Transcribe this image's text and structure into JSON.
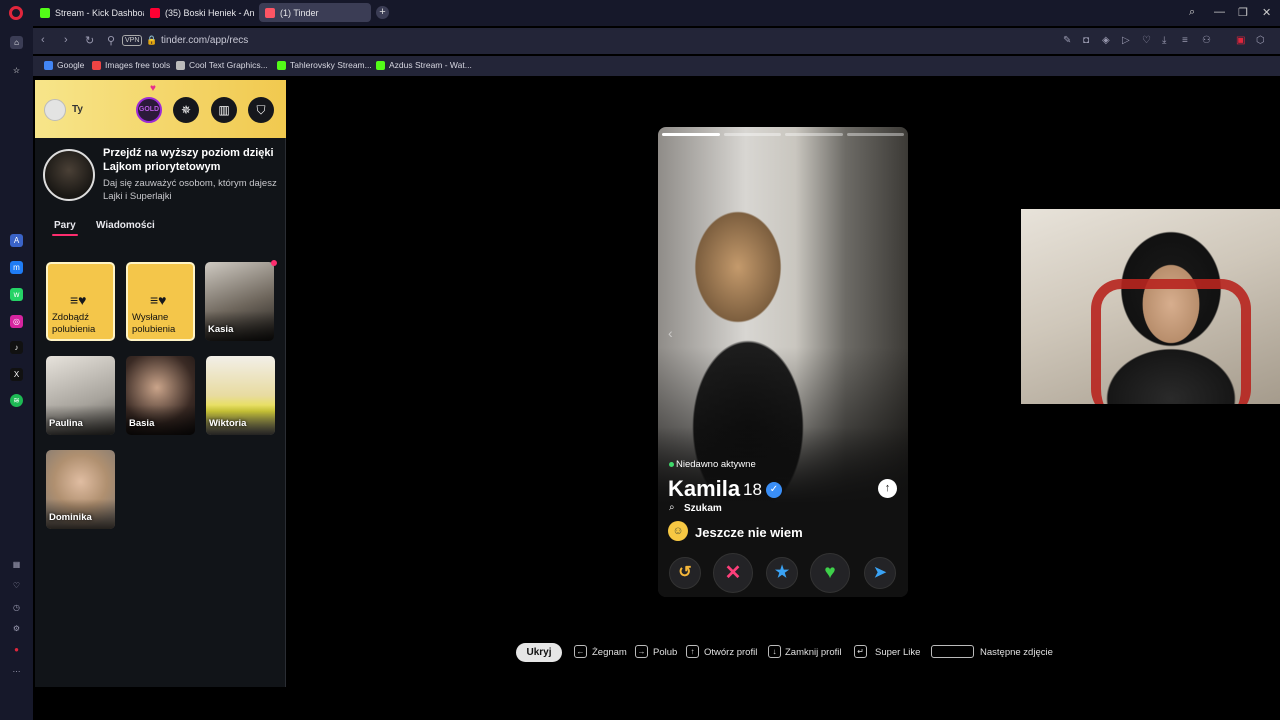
{
  "browser": {
    "tabs": [
      {
        "label": "Stream - Kick Dashboard",
        "color": "#53fc18"
      },
      {
        "label": "(35) Boski Heniek - An",
        "color": "#ff0033"
      },
      {
        "label": "(1) Tinder",
        "color": "#fd5564"
      }
    ],
    "url": "tinder.com/app/recs",
    "vpn": "VPN",
    "bookmarks": [
      {
        "label": "Google",
        "color": "#4285f4"
      },
      {
        "label": "Images free tools",
        "color": "#e44"
      },
      {
        "label": "Cool Text Graphics...",
        "color": "#bbb"
      },
      {
        "label": "Tahlerovsky Stream...",
        "color": "#53fc18"
      },
      {
        "label": "Azdus Stream - Wat...",
        "color": "#53fc18"
      }
    ]
  },
  "panel": {
    "user_label": "Ty",
    "gold_badge": "GOLD",
    "promo": {
      "title": "Przejdź na wyższy poziom dzięki Lajkom priorytetowym",
      "subtitle": "Daj się zauważyć osobom, którym dajesz Lajki i Superlajki"
    },
    "tabs": {
      "matches": "Pary",
      "messages": "Wiadomości"
    },
    "gold_cards": [
      {
        "label": "Zdobądź polubienia"
      },
      {
        "label": "Wysłane polubienia"
      }
    ],
    "matches": [
      {
        "name": "Kasia"
      },
      {
        "name": "Paulina"
      },
      {
        "name": "Basia"
      },
      {
        "name": "Wiktoria"
      },
      {
        "name": "Dominika"
      }
    ]
  },
  "profile": {
    "status": "Niedawno aktywne",
    "name": "Kamila",
    "age": "18",
    "looking_label": "Szukam",
    "intent": "Jeszcze nie wiem",
    "photo_count": 4,
    "current_photo": 1
  },
  "shortcuts": {
    "hide": "Ukryj",
    "items": [
      {
        "key": "←",
        "label": "Żegnam"
      },
      {
        "key": "→",
        "label": "Polub"
      },
      {
        "key": "↑",
        "label": "Otwórz profil"
      },
      {
        "key": "↓",
        "label": "Zamknij profil"
      },
      {
        "key": "↵",
        "label": "Super Like"
      },
      {
        "key": "",
        "label": "Następne zdjęcie"
      }
    ]
  },
  "colors": {
    "tinder_pink": "#fd2d6e",
    "gold": "#f4c64a",
    "opera_red": "#e0263c"
  }
}
